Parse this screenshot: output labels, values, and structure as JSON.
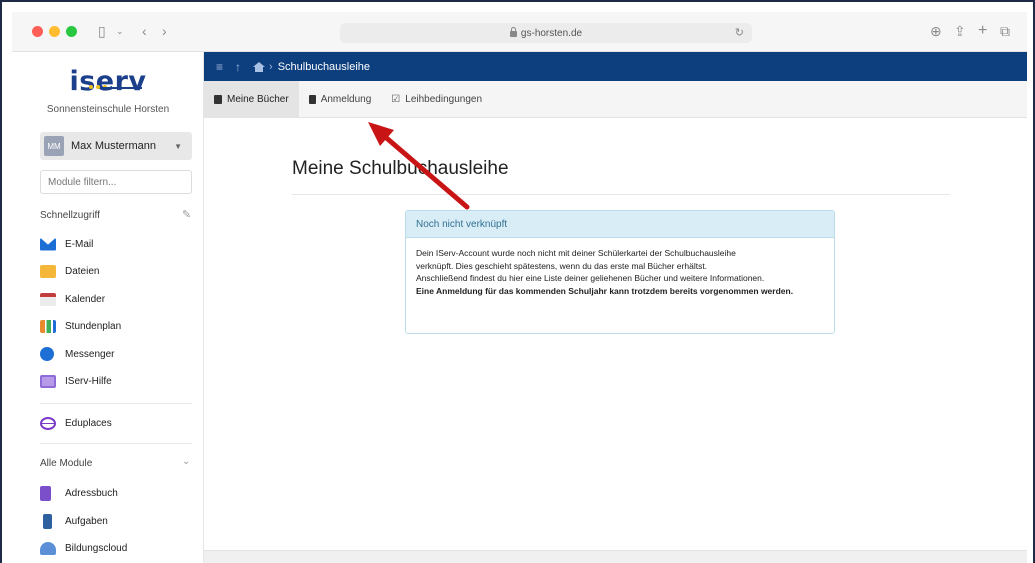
{
  "browser": {
    "url": "gs-horsten.de"
  },
  "sidebar": {
    "logo": "iserv",
    "school": "Sonnensteinschule Horsten",
    "user": {
      "initials": "MM",
      "name": "Max Mustermann"
    },
    "filter_placeholder": "Module filtern...",
    "quick_access_title": "Schnellzugriff",
    "quick_items": [
      {
        "label": "E-Mail",
        "icon": "mail-icon",
        "color": "#1d6fd6"
      },
      {
        "label": "Dateien",
        "icon": "folder-icon",
        "color": "#f4b73a"
      },
      {
        "label": "Kalender",
        "icon": "calendar-icon",
        "color": "#c43d3d"
      },
      {
        "label": "Stundenplan",
        "icon": "timetable-icon",
        "color": "#e88b2e"
      },
      {
        "label": "Messenger",
        "icon": "chat-icon",
        "color": "#1d6fd6"
      },
      {
        "label": "IServ-Hilfe",
        "icon": "help-icon",
        "color": "#8e6bd6"
      }
    ],
    "extra_item": {
      "label": "Eduplaces",
      "icon": "eduplaces-icon",
      "color": "#7a3bc8"
    },
    "all_modules_title": "Alle Module",
    "all_modules": [
      {
        "label": "Adressbuch",
        "icon": "addressbook-icon",
        "color": "#7a4fc9"
      },
      {
        "label": "Aufgaben",
        "icon": "tasks-icon",
        "color": "#2e5f9e"
      },
      {
        "label": "Bildungscloud",
        "icon": "cloud-icon",
        "color": "#5b8fd6"
      }
    ]
  },
  "topbar": {
    "breadcrumb": "Schulbuchausleihe"
  },
  "subnav": {
    "tabs": [
      {
        "label": "Meine Bücher",
        "active": true
      },
      {
        "label": "Anmeldung",
        "active": false
      },
      {
        "label": "Leihbedingungen",
        "active": false
      }
    ]
  },
  "main": {
    "title": "Meine Schulbuchausleihe",
    "alert": {
      "heading": "Noch nicht verknüpft",
      "body_lines": [
        "Dein IServ-Account wurde noch nicht mit deiner Schülerkartei der Schulbuchausleihe",
        "verknüpft. Dies geschieht spätestens, wenn du das erste mal Bücher erhältst.",
        "Anschließend findest du hier eine Liste deiner geliehenen Bücher und weitere Informationen."
      ],
      "strong_text": "Eine Anmeldung für das kommenden Schuljahr kann trotzdem bereits vorgenommen werden."
    }
  },
  "annotation": {
    "arrow_color": "#c81414"
  }
}
